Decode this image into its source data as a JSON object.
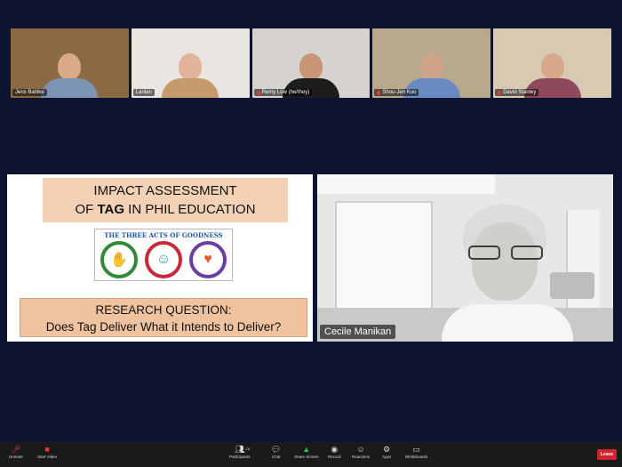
{
  "participants": [
    {
      "name": "Jens Bahlke",
      "bg": "#8a6a45",
      "shirt": "#7d93b4",
      "muted": false
    },
    {
      "name": "Lanlan",
      "bg": "#e9e6e2",
      "shirt": "#c79a6c",
      "muted": false
    },
    {
      "name": "Remy Low (he/they)",
      "bg": "#d6d3ce",
      "shirt": "#1c1c1c",
      "muted": true
    },
    {
      "name": "Shou-Jen Kuo",
      "bg": "#b9a98c",
      "shirt": "#6a8ac2",
      "muted": true
    },
    {
      "name": "David Stanley",
      "bg": "#d8c9b3",
      "shirt": "#8e4a5a",
      "muted": true
    }
  ],
  "slide": {
    "title_line1": "IMPACT ASSESSMENT",
    "title_line2_pre": "OF ",
    "title_line2_bold": "TAG",
    "title_line2_post": " IN PHIL EDUCATION",
    "logo_text": "THE THREE   ACTS OF   GOODNESS",
    "logo_left_symbol": "✋",
    "logo_mid_symbol": "☺",
    "logo_right_symbol": "♥",
    "question_line1": "RESEARCH QUESTION:",
    "question_line2": "Does Tag Deliver What it Intends to Deliver?"
  },
  "speaker": {
    "name": "Cecile Manikan"
  },
  "toolbar": {
    "unmute": "Unmute",
    "start_video": "Start Video",
    "participants": "Participants",
    "participants_count": "18",
    "chat": "Chat",
    "share_screen": "Share Screen",
    "record": "Record",
    "reactions": "Reactions",
    "apps": "Apps",
    "whiteboards": "Whiteboards",
    "leave": "Leave"
  }
}
